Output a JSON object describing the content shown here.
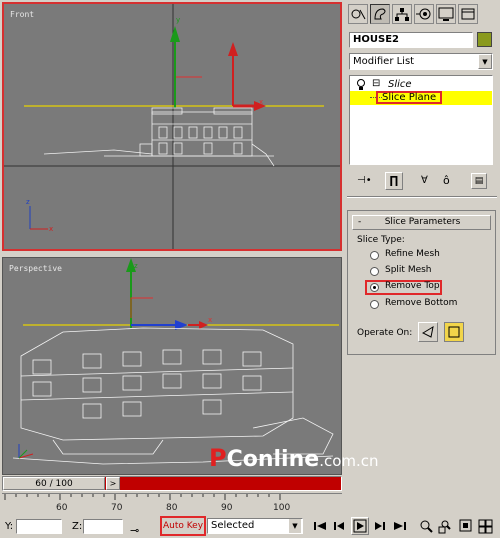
{
  "viewports": {
    "front": {
      "label": "Front"
    },
    "perspective": {
      "label": "Perspective"
    }
  },
  "command_panel": {
    "tab_icons": [
      "create-icon",
      "modify-icon",
      "hierarchy-icon",
      "motion-icon",
      "display-icon",
      "utilities-icon"
    ],
    "object_name": "HOUSE2",
    "object_color": "#8a9a1e",
    "modifier_list": "Modifier List",
    "stack": {
      "modifier": "Slice",
      "sub_object": "Slice Plane",
      "expand_symbol": "⊟"
    },
    "rollout": {
      "minus": "-",
      "title": "Slice Parameters",
      "slice_type_label": "Slice Type:",
      "options": [
        {
          "label": "Refine Mesh",
          "selected": false
        },
        {
          "label": "Split Mesh",
          "selected": false
        },
        {
          "label": "Remove Top",
          "selected": true
        },
        {
          "label": "Remove Bottom",
          "selected": false
        }
      ],
      "operate_on_label": "Operate On:"
    }
  },
  "timeline": {
    "frame_display": "60 / 100",
    "ticks": [
      "60",
      "70",
      "80",
      "90",
      "100"
    ],
    "slider_color": "#c00000"
  },
  "statusbar": {
    "y_label": "Y:",
    "z_label": "Z:",
    "auto_key": "Auto Key",
    "key_filter": "Selected"
  },
  "watermark": {
    "brand_p": "P",
    "brand_rest": "Conline",
    "domain": ".com.cn"
  },
  "highlight_color": "#e0282a"
}
